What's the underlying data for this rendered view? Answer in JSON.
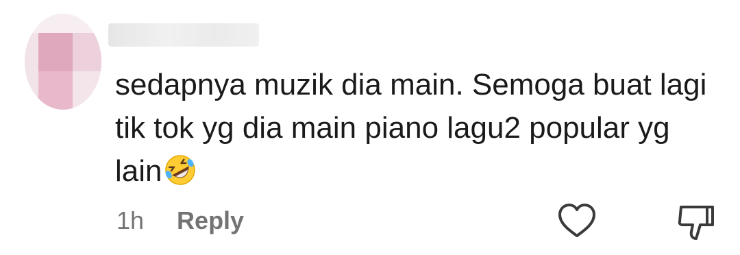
{
  "comment": {
    "text": "sedapnya muzik dia main. Semoga buat lagi tik tok yg dia main piano lagu2 popular yg lain",
    "emoji_name": "rolling-on-the-floor-laughing-icon",
    "timestamp": "1h",
    "reply_label": "Reply"
  },
  "icons": {
    "like": "heart-icon",
    "dislike": "thumbs-down-icon"
  },
  "colors": {
    "text": "#1a1a1a",
    "meta_text": "#737373",
    "icon_stroke": "#3a3a3a",
    "avatar_pink": "#e2a9bf"
  }
}
